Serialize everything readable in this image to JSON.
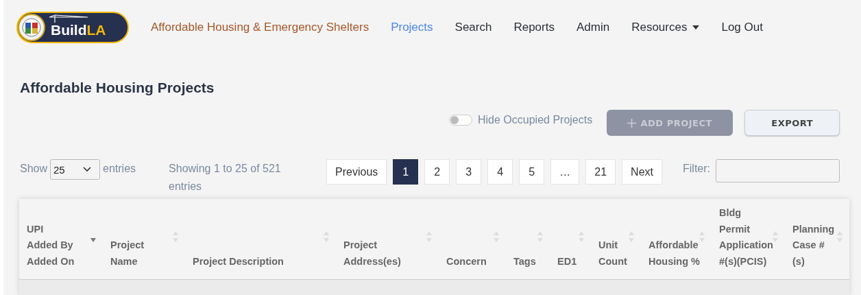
{
  "nav": {
    "logo": {
      "word": "Build",
      "accent": "LA"
    },
    "brand_link": "Affordable Housing & Emergency Shelters",
    "items": [
      {
        "label": "Projects",
        "selected": true,
        "dropdown": false
      },
      {
        "label": "Search",
        "selected": false,
        "dropdown": false
      },
      {
        "label": "Reports",
        "selected": false,
        "dropdown": false
      },
      {
        "label": "Admin",
        "selected": false,
        "dropdown": false
      },
      {
        "label": "Resources",
        "selected": false,
        "dropdown": true
      },
      {
        "label": "Log Out",
        "selected": false,
        "dropdown": false
      }
    ]
  },
  "page_title": "Affordable Housing Projects",
  "toggle": {
    "label": "Hide Occupied Projects",
    "on": false
  },
  "buttons": [
    {
      "label": "ADD PROJECT",
      "kind": "add",
      "disabled": true
    },
    {
      "label": "EXPORT",
      "kind": "export",
      "disabled": false
    }
  ],
  "length": {
    "prefix": "Show",
    "value": "25",
    "suffix": "entries"
  },
  "info": "Showing 1 to 25 of 521 entries",
  "pagination": [
    {
      "label": "Previous",
      "selected": false
    },
    {
      "label": "1",
      "selected": true
    },
    {
      "label": "2",
      "selected": false
    },
    {
      "label": "3",
      "selected": false
    },
    {
      "label": "4",
      "selected": false
    },
    {
      "label": "5",
      "selected": false
    },
    {
      "label": "…",
      "selected": false
    },
    {
      "label": "21",
      "selected": false
    },
    {
      "label": "Next",
      "selected": false
    }
  ],
  "filter": {
    "label": "Filter:"
  },
  "table": {
    "columns": [
      {
        "lines": [
          "UPI",
          "Added By",
          "Added On"
        ],
        "sorted_desc": true
      },
      {
        "lines": [
          "Project",
          "Name"
        ],
        "sorted_desc": false
      },
      {
        "lines": [
          "Project Description"
        ],
        "sorted_desc": false
      },
      {
        "lines": [
          "Project",
          "Address(es)"
        ],
        "sorted_desc": false
      },
      {
        "lines": [
          "Concern"
        ],
        "sorted_desc": false
      },
      {
        "lines": [
          "Tags"
        ],
        "sorted_desc": false
      },
      {
        "lines": [
          "ED1"
        ],
        "sorted_desc": false
      },
      {
        "lines": [
          "Unit",
          "Count"
        ],
        "sorted_desc": false
      },
      {
        "lines": [
          "Affordable",
          "Housing %"
        ],
        "sorted_desc": false
      },
      {
        "lines": [
          "Bldg",
          "Permit",
          "Application",
          "#(s)(PCIS)"
        ],
        "sorted_desc": false
      },
      {
        "lines": [
          "Planning",
          "Case #",
          "(s)"
        ],
        "sorted_desc": false
      }
    ]
  }
}
